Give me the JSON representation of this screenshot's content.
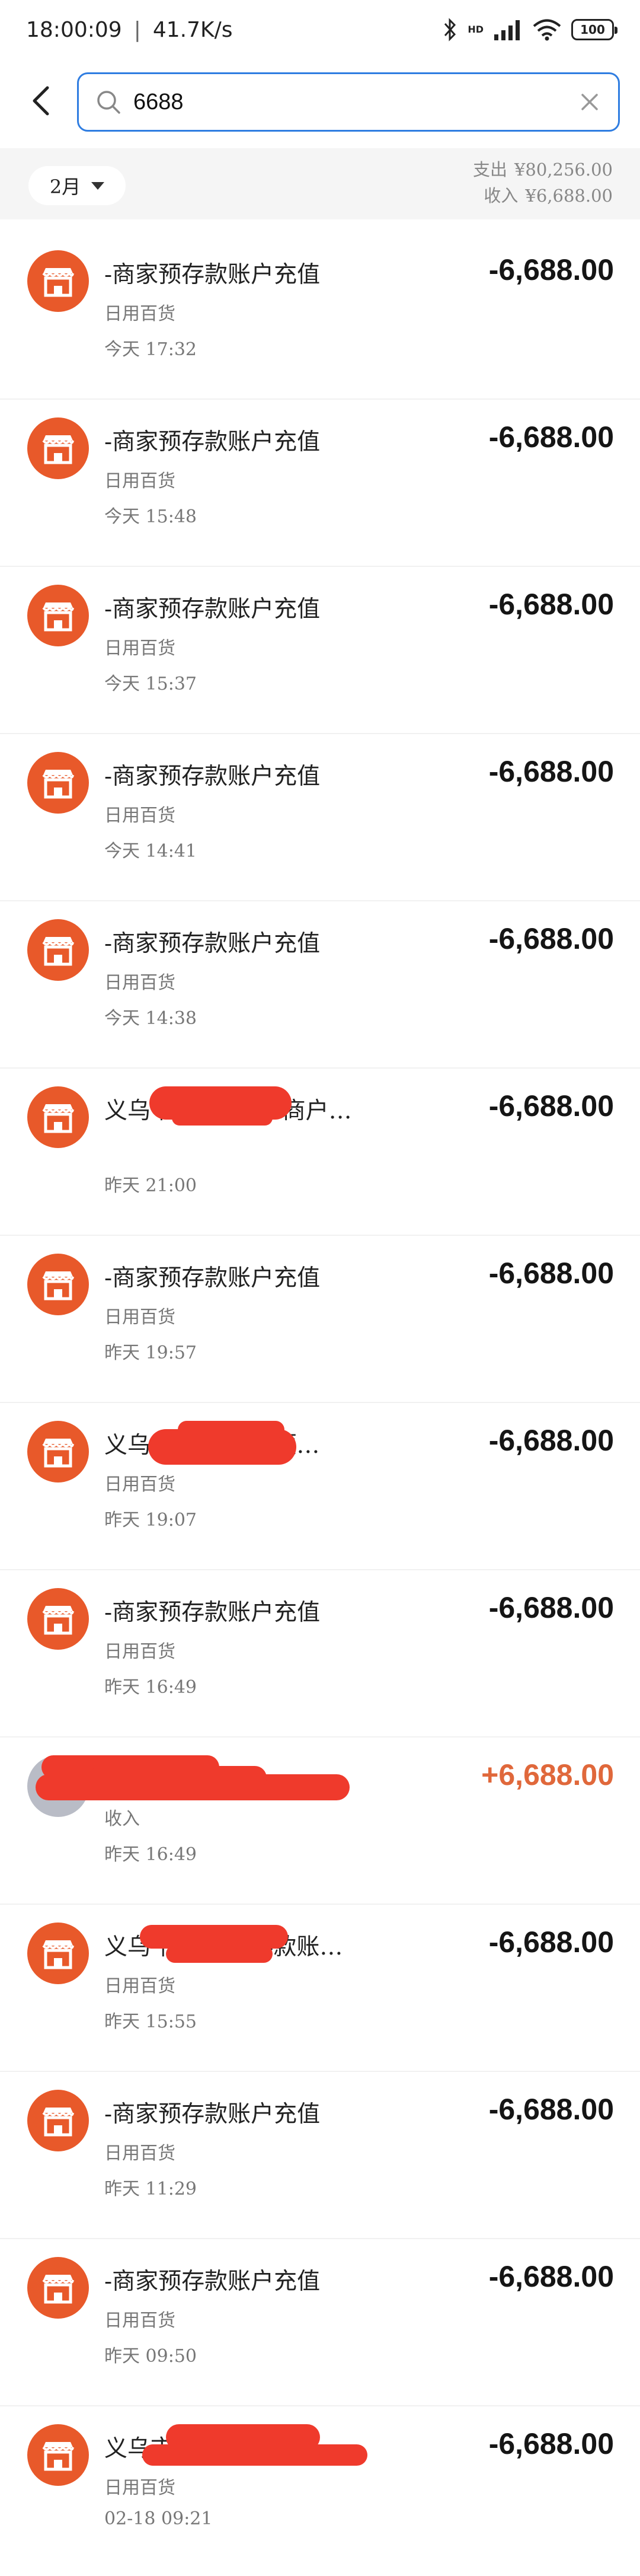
{
  "status_bar": {
    "time": "18:00:09",
    "speed": "41.7K/s",
    "battery": "100",
    "network_badge": "HD"
  },
  "search": {
    "value": "6688",
    "placeholder": ""
  },
  "summary": {
    "month": "2月",
    "expense_label": "支出",
    "expense_value": "¥80,256.00",
    "income_label": "收入",
    "income_value": "¥6,688.00"
  },
  "transactions": [
    {
      "title": "-商家预存款账户充值",
      "category": "日用百货",
      "time": "今天 17:32",
      "amount": "-6,688.00"
    },
    {
      "title": "-商家预存款账户充值",
      "category": "日用百货",
      "time": "今天 15:48",
      "amount": "-6,688.00"
    },
    {
      "title": "-商家预存款账户充值",
      "category": "日用百货",
      "time": "今天 15:37",
      "amount": "-6,688.00"
    },
    {
      "title": "-商家预存款账户充值",
      "category": "日用百货",
      "time": "今天 14:41",
      "amount": "-6,688.00"
    },
    {
      "title": "-商家预存款账户充值",
      "category": "日用百货",
      "time": "今天 14:38",
      "amount": "-6,688.00"
    },
    {
      "title": "义乌                商行(个体工商户…",
      "category": "",
      "time": "昨天 21:00",
      "amount": "-6,688.00"
    },
    {
      "title": "-商家预存款账户充值",
      "category": "日用百货",
      "time": "昨天 19:57",
      "amount": "-6,688.00"
    },
    {
      "title": "义乌              限公司商家预…",
      "category": "日用百货",
      "time": "昨天 19:07",
      "amount": "-6,688.00"
    },
    {
      "title": "-商家预存款账户充值",
      "category": "日用百货",
      "time": "昨天 16:49",
      "amount": "-6,688.00"
    },
    {
      "title": "",
      "category": "收入",
      "time": "昨天 16:49",
      "amount": "+6,688.00"
    },
    {
      "title": "义乌              行商家预存款账…",
      "category": "日用百货",
      "time": "昨天 15:55",
      "amount": "-6,688.00"
    },
    {
      "title": "-商家预存款账户充值",
      "category": "日用百货",
      "time": "昨天 11:29",
      "amount": "-6,688.00"
    },
    {
      "title": "-商家预存款账户充值",
      "category": "日用百货",
      "time": "昨天 09:50",
      "amount": "-6,688.00"
    },
    {
      "title": "义乌市                  商家预…",
      "category": "日用百货",
      "time": "02-18 09:21",
      "amount": "-6,688.00"
    }
  ],
  "colors": {
    "accent_border": "#2f7de1",
    "shop_icon": "#e8592a",
    "income": "#e0683b",
    "redaction": "#ef3a2c"
  },
  "icons": {
    "back": "chevron-left-icon",
    "search": "search-icon",
    "clear": "close-icon",
    "shop": "shop-icon"
  }
}
